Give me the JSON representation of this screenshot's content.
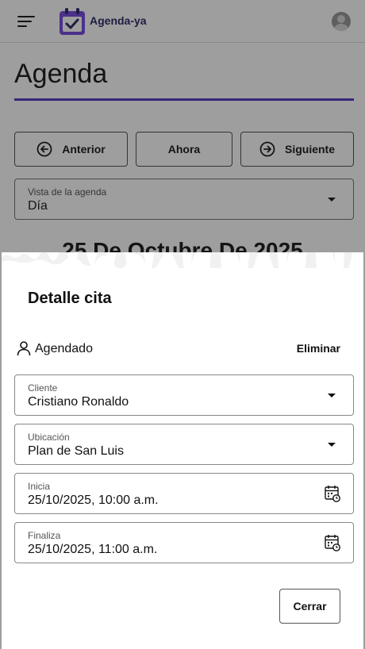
{
  "app": {
    "brand": "Agenda-ya"
  },
  "page": {
    "title": "Agenda",
    "accent": "#5b3fc4"
  },
  "nav": {
    "prev_label": "Anterior",
    "now_label": "Ahora",
    "next_label": "Siguiente"
  },
  "view_select": {
    "label": "Vista de la agenda",
    "value": "Día"
  },
  "date_heading": "25 De Octubre De 2025",
  "modal": {
    "title": "Detalle cita",
    "status": "Agendado",
    "delete_label": "Eliminar",
    "client": {
      "label": "Cliente",
      "value": "Cristiano Ronaldo"
    },
    "location": {
      "label": "Ubicación",
      "value": "Plan de San Luis"
    },
    "start": {
      "label": "Inicia",
      "value": "25/10/2025, 10:00 a.m."
    },
    "end": {
      "label": "Finaliza",
      "value": "25/10/2025, 11:00 a.m."
    },
    "close_label": "Cerrar"
  },
  "icons": {
    "menu": "menu-icon",
    "logo": "calendar-check-icon",
    "avatar": "user-avatar-icon",
    "prev": "arrow-left-circle-icon",
    "next": "arrow-right-circle-icon",
    "person": "person-icon",
    "calendar": "calendar-clock-icon"
  }
}
